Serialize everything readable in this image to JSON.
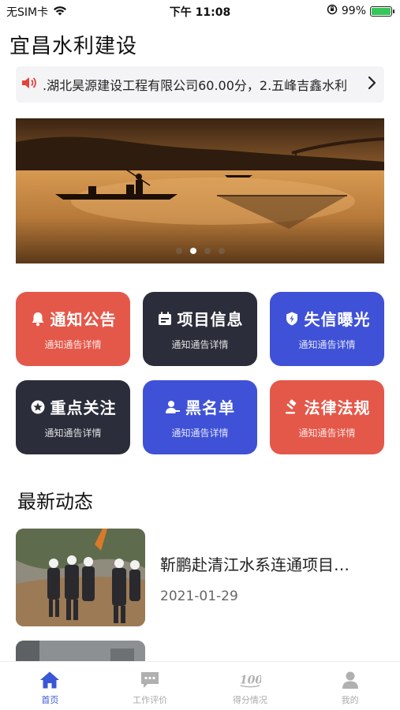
{
  "status": {
    "carrier": "无SIM卡",
    "time": "下午 11:08",
    "battery_percent": "99%",
    "battery_level": 0.99
  },
  "app": {
    "title": "宜昌水利建设"
  },
  "notice": {
    "text": ".湖北昊源建设工程有限公司60.00分，2.五峰吉鑫水利"
  },
  "banner": {
    "slide_count": 4,
    "active_slide": 1
  },
  "menu": [
    {
      "title": "通知公告",
      "subtitle": "通知通告详情",
      "icon": "bell-icon",
      "color": "#e4584a"
    },
    {
      "title": "项目信息",
      "subtitle": "通知通告详情",
      "icon": "calendar-icon",
      "color": "#2b2d3a"
    },
    {
      "title": "失信曝光",
      "subtitle": "通知通告详情",
      "icon": "shield-icon",
      "color": "#3f51d6"
    },
    {
      "title": "重点关注",
      "subtitle": "通知通告详情",
      "icon": "star-circle-icon",
      "color": "#2b2d3a"
    },
    {
      "title": "黑名单",
      "subtitle": "通知通告详情",
      "icon": "user-minus-icon",
      "color": "#3f51d6"
    },
    {
      "title": "法律法规",
      "subtitle": "通知通告详情",
      "icon": "gavel-icon",
      "color": "#e4584a"
    }
  ],
  "news": {
    "section_title": "最新动态",
    "items": [
      {
        "title": "靳鹏赴清江水系连通项目…",
        "date": "2021-01-29"
      }
    ]
  },
  "tabs": [
    {
      "label": "首页",
      "icon": "home-icon",
      "active": true
    },
    {
      "label": "工作评价",
      "icon": "chat-icon",
      "active": false
    },
    {
      "label": "得分情况",
      "icon": "score-icon",
      "active": false
    },
    {
      "label": "我的",
      "icon": "person-icon",
      "active": false
    }
  ],
  "colors": {
    "accent": "#3a57d8",
    "red": "#e4584a",
    "dark": "#2b2d3a",
    "blue": "#3f51d6"
  }
}
